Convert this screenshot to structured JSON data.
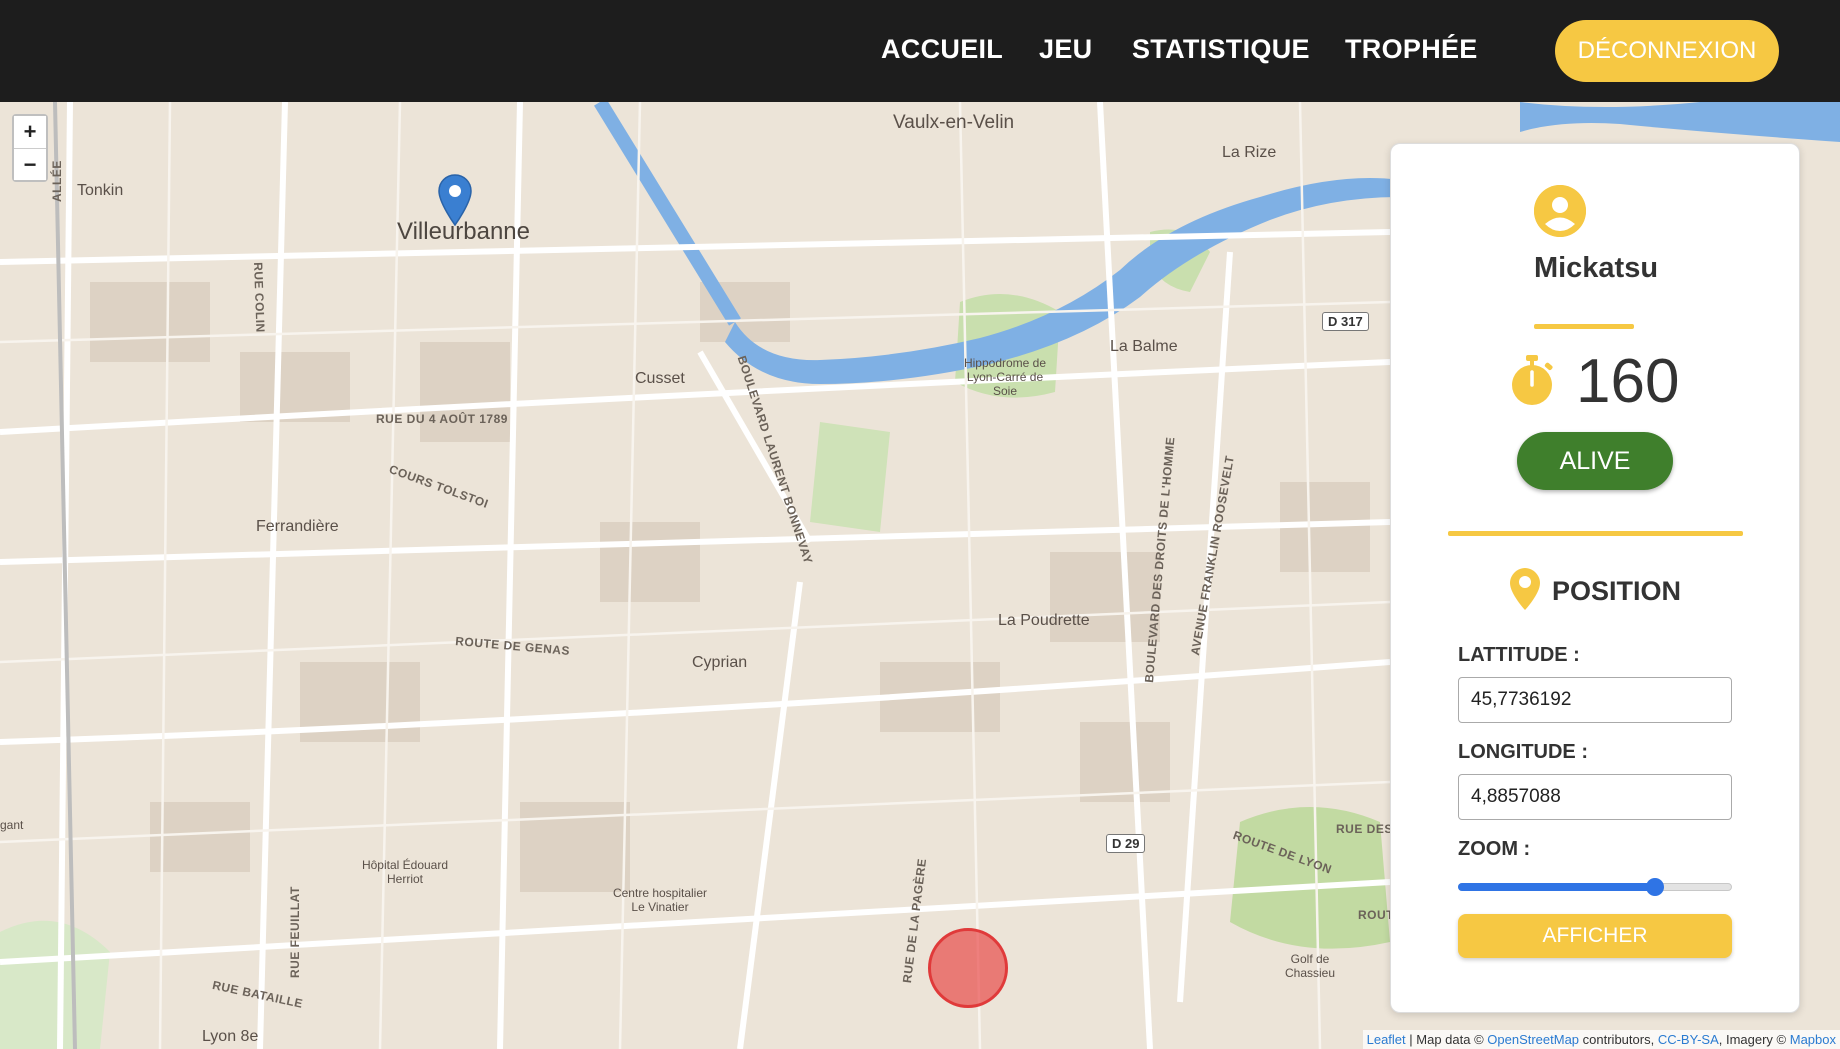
{
  "nav": {
    "items": [
      "ACCUEIL",
      "JEU",
      "STATISTIQUE",
      "TROPHÉE"
    ],
    "logout_label": "DÉCONNEXION"
  },
  "map": {
    "zoom_in": "+",
    "zoom_out": "−",
    "places": {
      "villeurbanne": "Villeurbanne",
      "vaulx": "Vaulx-en-Velin",
      "la_rize": "La Rize",
      "tonkin": "Tonkin",
      "cusset": "Cusset",
      "la_balme": "La Balme",
      "ferrandiere": "Ferrandière",
      "la_poudrette": "La Poudrette",
      "cyprian": "Cyprian",
      "hippodrome": "Hippodrome de Lyon-Carré de Soie",
      "hopital": "Hôpital Édouard Herriot",
      "centre_hosp": "Centre hospitalier Le Vinatier",
      "golf": "Golf de Chassieu",
      "lyon8": "Lyon 8e",
      "gant": "gant"
    },
    "streets": {
      "rue_colin": "RUE COLIN",
      "allee": "ALLÉE",
      "rue_4aout": "RUE DU 4 AOÛT 1789",
      "cours_tolstoi": "COURS TOLSTOI",
      "bd_bonnevay": "BOULEVARD LAURENT BONNEVAY",
      "route_genas": "ROUTE DE GENAS",
      "bd_droits": "BOULEVARD DES DROITS DE L'HOMME",
      "av_roosevelt": "AVENUE FRANKLIN ROOSEVELT",
      "route_lyon": "ROUTE DE LYON",
      "rue_des": "RUE DES",
      "rout": "ROUT",
      "rue_pagere": "RUE DE LA PAGÈRE",
      "rue_feuillat": "RUE FEUILLAT",
      "rue_bataille": "RUE BATAILLE"
    },
    "shields": {
      "d317": "D 317",
      "d29": "D 29"
    },
    "attribution": {
      "leaflet": "Leaflet",
      "sep1": " | Map data © ",
      "osm": "OpenStreetMap",
      "sep2": " contributors, ",
      "ccbysa": "CC-BY-SA",
      "sep3": ", Imagery © ",
      "mapbox": "Mapbox"
    }
  },
  "panel": {
    "user_icon": "user-circle-icon",
    "username": "Mickatsu",
    "timer_icon": "stopwatch-icon",
    "timer_value": "160",
    "status": "ALIVE",
    "status_color": "#3f7f2c",
    "position_icon": "map-pin-icon",
    "position_title": "POSITION",
    "latitude_label": "LATTITUDE :",
    "latitude_value": "45,7736192",
    "longitude_label": "LONGITUDE :",
    "longitude_value": "4,8857088",
    "zoom_label": "ZOOM :",
    "zoom_level": 0.72,
    "show_button": "AFFICHER"
  },
  "colors": {
    "accent": "#f6c843",
    "navbar": "#1d1d1d",
    "river": "#7fb0e4",
    "marker": "#3a7fd1",
    "circle": "#e03a3a",
    "slider": "#2f74e5"
  }
}
